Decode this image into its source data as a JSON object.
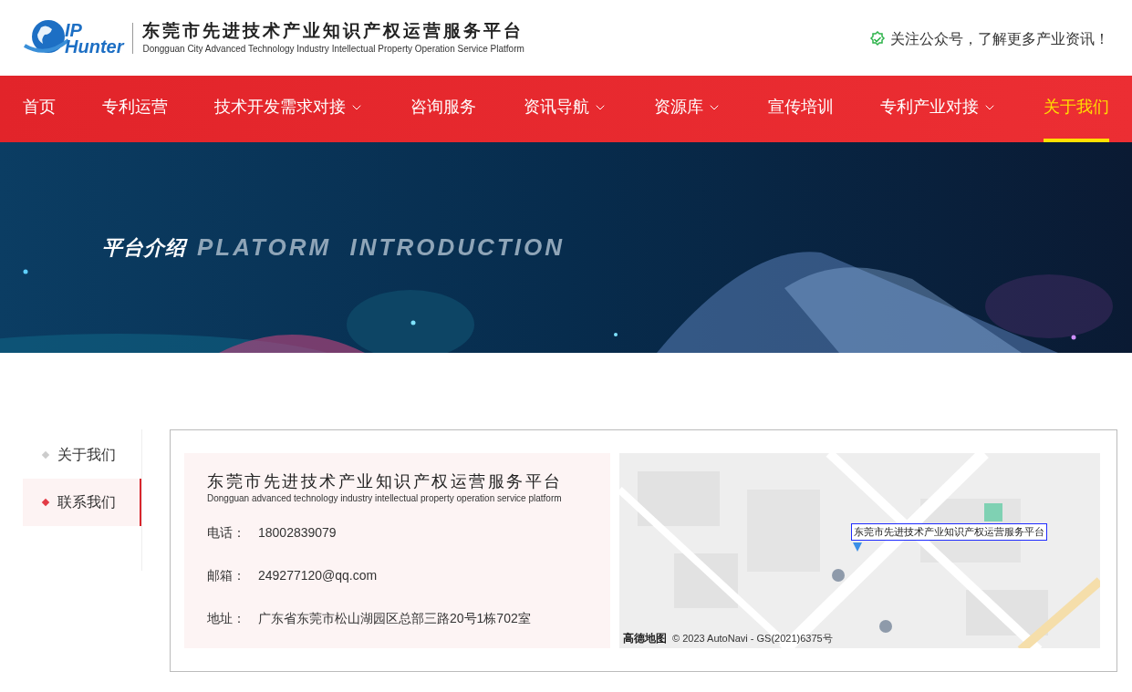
{
  "header": {
    "logo_text": [
      "IP",
      "Hunter"
    ],
    "title": "东莞市先进技术产业知识产权运营服务平台",
    "subtitle": "Dongguan City Advanced Technology Industry Intellectual Property Operation Service Platform",
    "notice": "关注公众号，了解更多产业资讯！"
  },
  "nav": [
    {
      "label": "首页",
      "dropdown": false,
      "selected": false
    },
    {
      "label": "专利运营",
      "dropdown": false,
      "selected": false
    },
    {
      "label": "技术开发需求对接",
      "dropdown": true,
      "selected": false
    },
    {
      "label": "咨询服务",
      "dropdown": false,
      "selected": false
    },
    {
      "label": "资讯导航",
      "dropdown": true,
      "selected": false
    },
    {
      "label": "资源库",
      "dropdown": true,
      "selected": false
    },
    {
      "label": "宣传培训",
      "dropdown": false,
      "selected": false
    },
    {
      "label": "专利产业对接",
      "dropdown": true,
      "selected": false
    },
    {
      "label": "关于我们",
      "dropdown": false,
      "selected": true
    }
  ],
  "banner": {
    "title_cn": "平台介绍",
    "title_en": "PLATORM  INTRODUCTION"
  },
  "sidebar": [
    {
      "label": "关于我们",
      "selected": false
    },
    {
      "label": "联系我们",
      "selected": true
    }
  ],
  "contact": {
    "title": "东莞市先进技术产业知识产权运营服务平台",
    "subtitle": "Dongguan advanced technology industry intellectual property operation service platform",
    "fields": [
      {
        "label": "电话：",
        "value": "18002839079"
      },
      {
        "label": "邮箱：",
        "value": "249277120@qq.com"
      },
      {
        "label": "地址：",
        "value": "广东省东莞市松山湖园区总部三路20号1栋702室"
      }
    ]
  },
  "map": {
    "marker_label": "东莞市先进技术产业知识产权运营服务平台",
    "brand": "高德地图",
    "copyright": "© 2023 AutoNavi - GS(2021)6375号"
  }
}
